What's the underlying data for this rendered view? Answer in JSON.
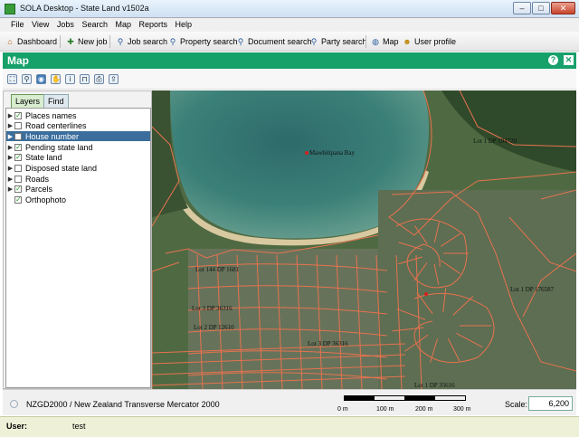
{
  "window": {
    "title": "SOLA Desktop - State Land v1502a",
    "controls": [
      "–",
      "□",
      "✕"
    ]
  },
  "menu": [
    "File",
    "View",
    "Jobs",
    "Search",
    "Map",
    "Reports",
    "Help"
  ],
  "toolbar": {
    "items": [
      {
        "label": "Dashboard",
        "icon": "home-icon"
      },
      {
        "label": "New job",
        "icon": "new-job-icon"
      },
      {
        "label": "Job search",
        "icon": "search-icon"
      },
      {
        "label": "Property search",
        "icon": "search-icon"
      },
      {
        "label": "Document search",
        "icon": "search-icon"
      },
      {
        "label": "Party search",
        "icon": "search-icon"
      },
      {
        "label": "Map",
        "icon": "globe-icon"
      },
      {
        "label": "User profile",
        "icon": "user-icon"
      }
    ]
  },
  "map_panel": {
    "title": "Map",
    "help": "?",
    "close": "✕"
  },
  "map_tools": [
    "full-extent-icon",
    "zoom-icon",
    "identify-pan-icon",
    "pan-icon",
    "info-icon",
    "measure-icon",
    "print-icon",
    "export-icon"
  ],
  "tabs": {
    "layers": "Layers",
    "find": "Find"
  },
  "layers": [
    {
      "name": "Places names",
      "checked": true,
      "expandable": true,
      "selected": false
    },
    {
      "name": "Road centerlines",
      "checked": false,
      "expandable": true,
      "selected": false
    },
    {
      "name": "House number",
      "checked": false,
      "expandable": true,
      "selected": true
    },
    {
      "name": "Pending state land",
      "checked": true,
      "expandable": true,
      "selected": false
    },
    {
      "name": "State land",
      "checked": true,
      "expandable": true,
      "selected": false
    },
    {
      "name": "Disposed state land",
      "checked": false,
      "expandable": true,
      "selected": false
    },
    {
      "name": "Roads",
      "checked": false,
      "expandable": true,
      "selected": false
    },
    {
      "name": "Parcels",
      "checked": true,
      "expandable": true,
      "selected": false
    },
    {
      "name": "Orthophoto",
      "checked": true,
      "expandable": false,
      "selected": false
    }
  ],
  "map_labels": {
    "bay": "Mawhitipana Bay",
    "lot1": "Lot 1 DP 194720",
    "lot2": "Lot 144 DP 1681",
    "lot3": "Lot 1 DP 176587",
    "lot4": "Lot 3 DP 36316",
    "lot5": "Lot 2 DP 12610",
    "lot6": "Lot 3 DP 36316",
    "lot7": "Lot 1 DP 35616"
  },
  "status": {
    "crs": "NZGD2000 / New Zealand Transverse Mercator 2000",
    "scale_label": "Scale:",
    "scale_value": "6,200",
    "scalebar_labels": [
      "0 m",
      "100 m",
      "200 m",
      "300 m"
    ]
  },
  "user": {
    "label": "User:",
    "value": "test"
  },
  "colors": {
    "header": "#16a06a",
    "parcel_line": "#e8724f",
    "selected_row": "#3b6e9c"
  }
}
